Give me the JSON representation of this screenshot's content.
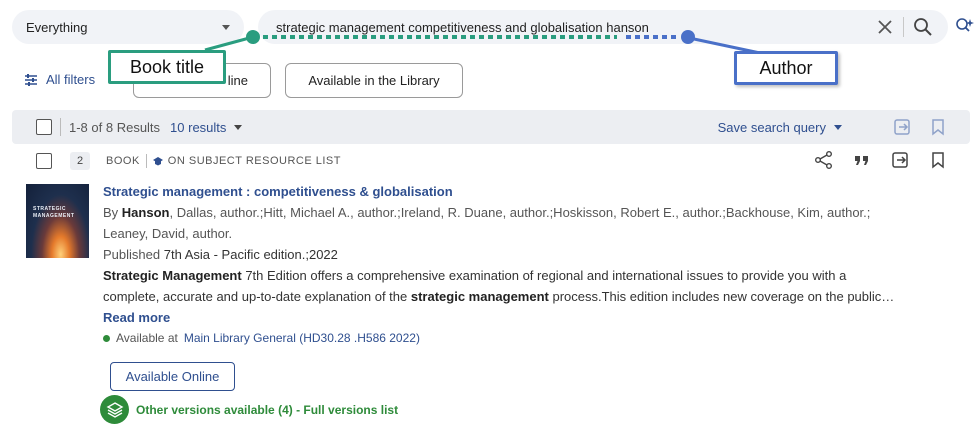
{
  "search": {
    "scope": "Everything",
    "query": "strategic management competitiveness and globalisation hanson"
  },
  "filters": {
    "all_filters": "All filters",
    "pill_online": "line",
    "pill_library": "Available in the Library"
  },
  "results_bar": {
    "count": "1-8 of 8 Results",
    "per_page": "10 results",
    "save_query": "Save search query"
  },
  "record": {
    "number": "2",
    "type": "BOOK",
    "subject_list": "ON SUBJECT RESOURCE LIST",
    "title": "Strategic management : competitiveness & globalisation",
    "authors_prefix": "By ",
    "authors_bold": "Hanson",
    "authors_line1": ", Dallas, author.;Hitt, Michael A., author.;Ireland, R. Duane, author.;Hoskisson, Robert E., author.;Backhouse, Kim, author.;",
    "authors_line2": "Leaney, David, author.",
    "published_label": "Published",
    "published_value": "7th Asia - Pacific edition.;2022",
    "desc_bold1": "Strategic Management",
    "desc_part1": " 7th Edition offers a comprehensive examination of regional and international issues to provide you with a",
    "desc_part2": "complete, accurate and up-to-date explanation of the ",
    "desc_bold2": "strategic management",
    "desc_part3": " process.This edition includes new coverage on the public…",
    "read_more": "Read more",
    "avail_label": "Available at",
    "avail_location": "Main Library General (HD30.28 .H586 2022)",
    "online_button": "Available Online",
    "versions": "Other versions available (4) - Full versions list",
    "cover_text": [
      "STRATEGIC",
      "MANAGEMENT"
    ]
  },
  "annotations": {
    "book_title": "Book title",
    "author": "Author"
  },
  "colors": {
    "link": "#2f4f8f",
    "available": "#2e8b3a",
    "title_annotation": "#2a9d7f",
    "author_annotation": "#4a70c8"
  }
}
